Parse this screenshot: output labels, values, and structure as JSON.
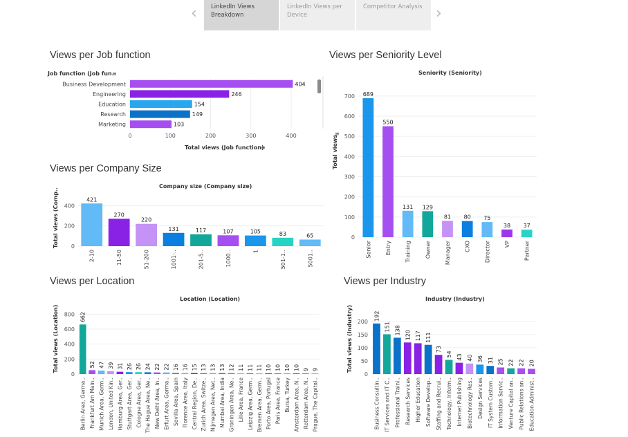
{
  "tabs": {
    "prev_icon": "chevron-left-icon",
    "next_icon": "chevron-right-icon",
    "items": [
      {
        "label_line1": "LinkedIn Views",
        "label_line2": "Breakdown",
        "active": true
      },
      {
        "label_line1": "LinkedIn Views per",
        "label_line2": "Device",
        "active": false
      },
      {
        "label_line1": "Competitor Analysis",
        "label_line2": "",
        "active": false
      }
    ]
  },
  "sections": {
    "job": "Views per Job function",
    "seniority": "Views per Seniority Level",
    "company": "Views per Company Size",
    "location": "Views per Location",
    "industry": "Views per Industry"
  },
  "chart_data": [
    {
      "id": "job",
      "type": "bar",
      "orientation": "horizontal",
      "ylabel": "Job function (Job fun..",
      "xlabel": "Total views (Job function)",
      "categories": [
        "Business Development",
        "Engineering",
        "Education",
        "Research",
        "Marketing"
      ],
      "values": [
        404,
        246,
        154,
        149,
        103
      ],
      "colors": [
        "#a64ff0",
        "#8a22e6",
        "#28a7ef",
        "#0b72c9",
        "#a64ff0"
      ],
      "xticks": [
        0,
        100,
        200,
        300,
        400
      ],
      "xlim": [
        0,
        460
      ]
    },
    {
      "id": "seniority",
      "type": "bar",
      "title": "Seniority (Seniority)",
      "ylabel": "Total views",
      "categories": [
        "Senior",
        "Entry",
        "Training",
        "Owner",
        "Manager",
        "CXO",
        "Director",
        "VP",
        "Partner"
      ],
      "values": [
        689,
        550,
        131,
        129,
        81,
        80,
        75,
        38,
        37
      ],
      "colors": [
        "#1a96ec",
        "#a64ff0",
        "#62baf7",
        "#12a79a",
        "#c592f5",
        "#0b7fe0",
        "#62baf7",
        "#9b38ec",
        "#27d4c4"
      ],
      "yticks": [
        0,
        100,
        200,
        300,
        400,
        500,
        600,
        700
      ],
      "ylim": [
        0,
        720
      ]
    },
    {
      "id": "company",
      "type": "bar",
      "title": "Company size (Company size)",
      "ylabel": "Total views (Comp..",
      "categories": [
        "2-10",
        "11-50",
        "51-200",
        "1001-..",
        "201-5..",
        "1000..",
        "1",
        "501-1..",
        "5001.."
      ],
      "values": [
        421,
        270,
        220,
        131,
        117,
        107,
        105,
        83,
        65
      ],
      "colors": [
        "#62baf7",
        "#8a22e6",
        "#c592f5",
        "#0b7fe0",
        "#12a79a",
        "#a64ff0",
        "#1a96ec",
        "#27d4c4",
        "#62baf7"
      ],
      "yticks": [
        0,
        200,
        400
      ],
      "ylim": [
        0,
        450
      ]
    },
    {
      "id": "location",
      "type": "bar",
      "title": "Location (Location)",
      "ylabel": "Total views (Location)",
      "categories": [
        "Berlin Area, Germa..",
        "Frankfurt Am Main..",
        "Munich Area, Germ..",
        "London, United Kin..",
        "Hamburg Area, Ger..",
        "Stuttgart Area, Ger..",
        "Cologne Area, Ger..",
        "The Hague Area, Ne..",
        "New Delhi Area, In..",
        "Erfurt Area, Germa..",
        "Sevilla Area, Spain",
        "Florence Area, Italy",
        "Central Region, De..",
        "Zurich Area, Switze..",
        "Nijmegen Area, Net..",
        "Mumbai Area, India",
        "Groningen Area, Ne..",
        "Lille Area, France",
        "Leipzig Area, Germ..",
        "Bremen Area, Germ..",
        "Porto Area, Portugal",
        "Paris Area, France",
        "Bursa, Turkey",
        "Amsterdam Area, N..",
        "Rotterdam Area, N..",
        "Prague, The Capital.."
      ],
      "values": [
        662,
        52,
        47,
        39,
        31,
        26,
        26,
        24,
        22,
        22,
        16,
        16,
        15,
        13,
        13,
        13,
        12,
        11,
        11,
        11,
        10,
        10,
        10,
        10,
        9,
        9
      ],
      "colors": [
        "#12a79a",
        "#a64ff0",
        "#62baf7",
        "#c592f5",
        "#8a22e6",
        "#1a96ec",
        "#27d4c4",
        "#0b7fe0",
        "#a64ff0",
        "#62baf7",
        "#12a79a",
        "#c592f5",
        "#8a22e6",
        "#1a96ec",
        "#27d4c4",
        "#0b7fe0",
        "#a64ff0",
        "#62baf7",
        "#12a79a",
        "#c592f5",
        "#8a22e6",
        "#1a96ec",
        "#27d4c4",
        "#0b7fe0",
        "#a64ff0",
        "#62baf7"
      ],
      "yticks": [
        0,
        200,
        400,
        600,
        800
      ],
      "ylim": [
        0,
        840
      ]
    },
    {
      "id": "industry",
      "type": "bar",
      "title": "Industry (Industry)",
      "ylabel": "Total views (Industry)",
      "categories": [
        "Business Consultin..",
        "IT Services and IT C..",
        "Professional Traini..",
        "Research Services",
        "Higher Education",
        "Software Develop..",
        "Staffing and Recrui..",
        "Technology, Inform..",
        "Internet Publishing",
        "Biotechnology Res..",
        "Design Services",
        "IT System Custom..",
        "Information Servic..",
        "Venture Capital an..",
        "Public Relations an..",
        "Education Administ.."
      ],
      "values": [
        192,
        151,
        138,
        120,
        117,
        111,
        73,
        54,
        43,
        40,
        36,
        31,
        25,
        22,
        22,
        20
      ],
      "colors": [
        "#0b72c9",
        "#12a79a",
        "#0b72c9",
        "#8a22e6",
        "#8a22e6",
        "#0b72c9",
        "#8a22e6",
        "#12a79a",
        "#8a22e6",
        "#c592f5",
        "#1a96ec",
        "#0b72c9",
        "#a64ff0",
        "#12a79a",
        "#a64ff0",
        "#a64ff0"
      ],
      "yticks": [
        0,
        50,
        100,
        150,
        200
      ],
      "ylim": [
        0,
        210
      ]
    }
  ]
}
